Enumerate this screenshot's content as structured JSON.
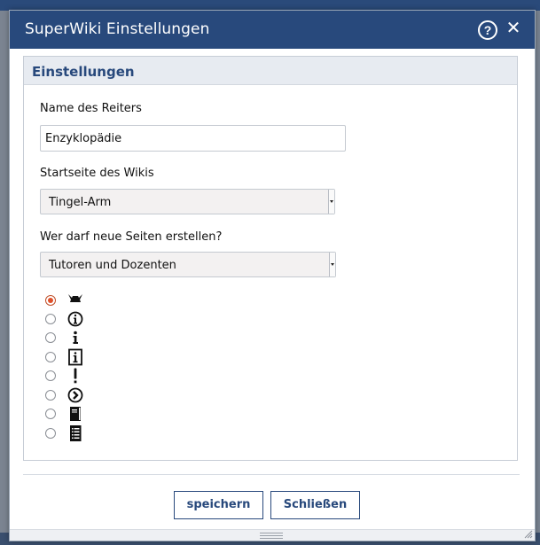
{
  "dialog": {
    "title": "SuperWiki Einstellungen",
    "help_label": "?",
    "close_label": "✕"
  },
  "section": {
    "legend": "Einstellungen"
  },
  "fields": {
    "tab_name_label": "Name des Reiters",
    "tab_name_value": "Enzyklopädie",
    "start_page_label": "Startseite des Wikis",
    "start_page_value": "Tingel-Arm",
    "create_permission_label": "Wer darf neue Seiten erstellen?",
    "create_permission_value": "Tutoren und Dozenten"
  },
  "icon_options": [
    {
      "icon": "viking-helmet-icon",
      "selected": true
    },
    {
      "icon": "info-circle-icon",
      "selected": false
    },
    {
      "icon": "info-icon",
      "selected": false
    },
    {
      "icon": "info-box-icon",
      "selected": false
    },
    {
      "icon": "exclamation-icon",
      "selected": false
    },
    {
      "icon": "arrow-circle-icon",
      "selected": false
    },
    {
      "icon": "book-icon",
      "selected": false
    },
    {
      "icon": "list-document-icon",
      "selected": false
    }
  ],
  "buttons": {
    "save_label": "speichern",
    "close_label": "Schließen"
  },
  "colors": {
    "titlebar": "#28497c",
    "accent": "#28497c",
    "radio_selected": "#e0502a"
  }
}
